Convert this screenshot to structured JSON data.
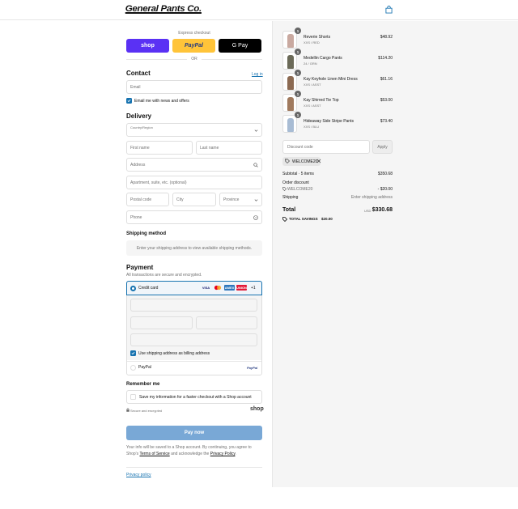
{
  "header": {
    "logo": "General Pants Co."
  },
  "express": {
    "title": "Express checkout",
    "shop_label": "shop",
    "paypal_label": "PayPal",
    "gpay_label": "G Pay",
    "or_label": "OR"
  },
  "contact": {
    "heading": "Contact",
    "login_link": "Log in",
    "email_placeholder": "Email",
    "newsletter_label": "Email me with news and offers"
  },
  "delivery": {
    "heading": "Delivery",
    "country_label": "Country/Region",
    "first_name": "First name",
    "last_name": "Last name",
    "address": "Address",
    "apartment": "Apartment, suite, etc. (optional)",
    "postal": "Postal code",
    "city": "City",
    "province": "Province",
    "phone": "Phone"
  },
  "shipping_method": {
    "heading": "Shipping method",
    "notice": "Enter your shipping address to view available shipping methods."
  },
  "payment": {
    "heading": "Payment",
    "subtitle": "All transactions are secure and encrypted.",
    "credit_card_label": "Credit card",
    "card_logos": [
      "VISA",
      "MC",
      "AMEX",
      "UNION"
    ],
    "more_cards": "+1",
    "billing_label": "Use shipping address as billing address",
    "paypal_label": "PayPal",
    "paypal_logo": "PayPal"
  },
  "remember": {
    "heading": "Remember me",
    "save_label": "Save my information for a faster checkout with a Shop account",
    "secure_label": "Secure and encrypted",
    "shop_logo": "shop"
  },
  "pay_now": "Pay now",
  "legal": {
    "text1": "Your info will be saved to a Shop account. By continuing, you agree to Shop's",
    "terms": "Terms of Service",
    "text2": "and acknowledge the",
    "privacy": "Privacy Policy",
    "text3": "."
  },
  "footer": {
    "privacy_policy": "Privacy policy"
  },
  "cart": {
    "items": [
      {
        "name": "Reverie Shorts",
        "variant": "XXS / RED",
        "price": "$48.92",
        "qty": "1",
        "color": "#c9a9a0"
      },
      {
        "name": "Medellin Cargo Pants",
        "variant": "24 / GRN",
        "price": "$114.20",
        "qty": "1",
        "color": "#6b6a58"
      },
      {
        "name": "Kay Keyhole Linen Mini Dress",
        "variant": "XXS / ASST",
        "price": "$61.16",
        "qty": "1",
        "color": "#8c6a52"
      },
      {
        "name": "Kay Shirred Tie Top",
        "variant": "XXS / ASST",
        "price": "$53.00",
        "qty": "1",
        "color": "#a07a5e"
      },
      {
        "name": "Hideaway Side Stripe Pants",
        "variant": "XXS / BLU",
        "price": "$73.40",
        "qty": "1",
        "color": "#a8bcd4"
      }
    ],
    "discount_placeholder": "Discount code",
    "apply_label": "Apply",
    "applied_code": "WELCOME20",
    "subtotal_label": "Subtotal · 5 items",
    "subtotal_value": "$350.68",
    "order_discount_label": "Order discount",
    "discount_code": "WELCOME20",
    "discount_value": "- $20.00",
    "shipping_label": "Shipping",
    "shipping_value": "Enter shipping address",
    "total_label": "Total",
    "currency": "USD",
    "total_value": "$330.68",
    "savings_label": "TOTAL SAVINGS",
    "savings_value": "$20.00"
  },
  "colors": {
    "accent": "#1773b0",
    "shop_purple": "#5a31f4",
    "paypal_yellow": "#ffc439",
    "pay_now_disabled": "#79a8d6"
  }
}
